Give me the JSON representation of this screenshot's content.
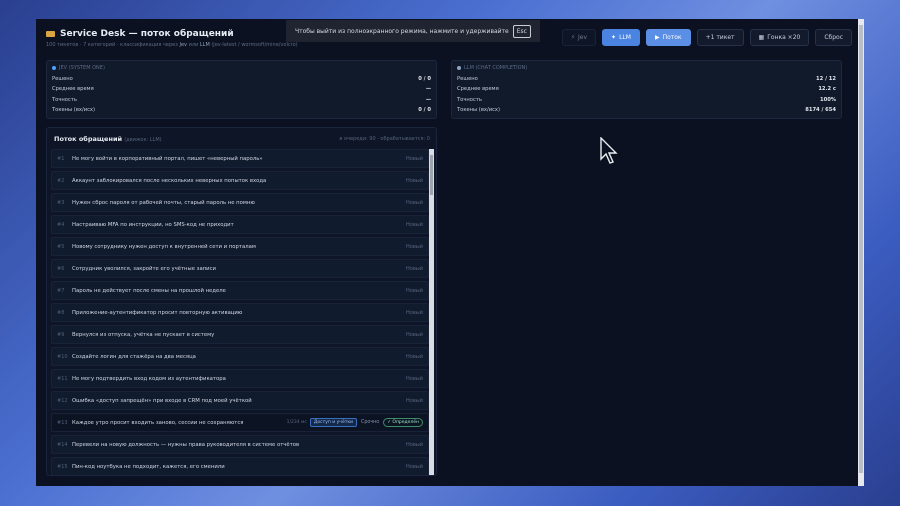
{
  "app": {
    "title": "Service Desk — поток обращений",
    "subtitle_pre": "100 тикетов · 7 категорий · классификация через",
    "subtitle_jev": "Jev",
    "subtitle_mid": "или",
    "subtitle_llm": "LLM",
    "subtitle_post": "(jev-latest / wormsoft/mine/volcro)"
  },
  "toolbar": {
    "jev_label": "Jev",
    "llm_label": "LLM",
    "flow_label": "Поток",
    "add_ticket_label": "+1 тикет",
    "race_label": "Гонка ×20",
    "reset_label": "Сброс"
  },
  "toast": {
    "text": "Чтобы выйти из полноэкранного режима, нажмите и удерживайте",
    "key": "Esc"
  },
  "stats_jev": {
    "header": "JEV (SYSTEM ONE)",
    "accent": "#4aa3ff",
    "rows": [
      {
        "label": "Решено",
        "value": "0 / 0"
      },
      {
        "label": "Среднее время",
        "value": "—"
      },
      {
        "label": "Точность",
        "value": "—"
      },
      {
        "label": "Токены (вх/исх)",
        "value": "0 / 0"
      }
    ]
  },
  "stats_llm": {
    "header": "LLM (CHAT COMPLETION)",
    "accent": "#8fa3c2",
    "rows": [
      {
        "label": "Решено",
        "value": "12 / 12"
      },
      {
        "label": "Среднее время",
        "value": "12.2 с"
      },
      {
        "label": "Точность",
        "value": "100%"
      },
      {
        "label": "Токены (вх/исх)",
        "value": "8174 / 654"
      }
    ]
  },
  "feed": {
    "title": "Поток обращений",
    "title_note": "(движок: LLM)",
    "status": "в очереди: 90 · обрабатывается: 0",
    "items": [
      {
        "num": "#1",
        "text": "Не могу войти в корпоративный портал, пишет «неверный пароль»",
        "status": "Новый"
      },
      {
        "num": "#2",
        "text": "Аккаунт заблокировался после нескольких неверных попыток входа",
        "status": "Новый"
      },
      {
        "num": "#3",
        "text": "Нужен сброс пароля от рабочей почты, старый пароль не помню",
        "status": "Новый"
      },
      {
        "num": "#4",
        "text": "Настраиваю MFA по инструкции, но SMS-код не приходит",
        "status": "Новый"
      },
      {
        "num": "#5",
        "text": "Новому сотруднику нужен доступ к внутренней сети и порталам",
        "status": "Новый"
      },
      {
        "num": "#6",
        "text": "Сотрудник уволился, закройте его учётные записи",
        "status": "Новый"
      },
      {
        "num": "#7",
        "text": "Пароль не действует после смены на прошлой неделе",
        "status": "Новый"
      },
      {
        "num": "#8",
        "text": "Приложение-аутентификатор просит повторную активацию",
        "status": "Новый"
      },
      {
        "num": "#9",
        "text": "Вернулся из отпуска, учётка не пускает в систему",
        "status": "Новый"
      },
      {
        "num": "#10",
        "text": "Создайте логин для стажёра на два месяца",
        "status": "Новый"
      },
      {
        "num": "#11",
        "text": "Не могу подтвердить вход кодом из аутентификатора",
        "status": "Новый"
      },
      {
        "num": "#12",
        "text": "Ошибка «доступ запрещён» при входе в CRM под моей учёткой",
        "status": "Новый"
      }
    ],
    "active_item": {
      "num": "#13",
      "text": "Каждое утро просит входить заново, сессии не сохраняются",
      "meta": "1/234 мс",
      "category": "Доступ и учётки",
      "priority": "Срочно",
      "result": "✓ Определён"
    },
    "tail_items": [
      {
        "num": "#14",
        "text": "Перевели на новую должность — нужны права руководителя в системе отчётов",
        "status": "Новый"
      },
      {
        "num": "#15",
        "text": "Пин-код ноутбука не подходит, кажется, его сменили",
        "status": "Новый"
      }
    ]
  }
}
